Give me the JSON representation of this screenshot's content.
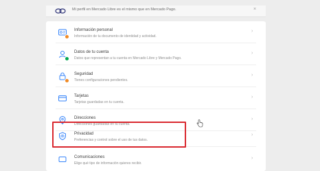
{
  "banner": {
    "message": "Mi perfil en Mercado Libre es el mismo que en Mercado Pago.",
    "close_label": "×",
    "logo_icon": "mercadolibre-handshake-icon"
  },
  "settings": [
    {
      "title": "Información personal",
      "desc": "Información de tu documento de identidad y actividad.",
      "icon": "id-card-icon",
      "badge": "orange"
    },
    {
      "title": "Datos de tu cuenta",
      "desc": "Datos que representan a tu cuenta en Mercado Libre y Mercado Pago.",
      "icon": "user-icon",
      "badge": "green"
    },
    {
      "title": "Seguridad",
      "desc": "Tienes configuraciones pendientes.",
      "icon": "lock-icon",
      "badge": "orange"
    },
    {
      "title": "Tarjetas",
      "desc": "Tarjetas guardadas en tu cuenta.",
      "icon": "card-icon",
      "badge": ""
    },
    {
      "title": "Direcciones",
      "desc": "Direcciones guardadas en tu cuenta.",
      "icon": "location-pin-icon",
      "badge": ""
    },
    {
      "title": "Privacidad",
      "desc": "Preferencias y control sobre el uso de tus datos.",
      "icon": "privacy-icon",
      "badge": ""
    },
    {
      "title": "Comunicaciones",
      "desc": "Elige qué tipo de información quieres recibir.",
      "icon": "chat-icon",
      "badge": ""
    }
  ],
  "chevron": "›",
  "colors": {
    "accent": "#3483fa",
    "badge_orange": "#f08a24",
    "badge_green": "#00a650",
    "highlight": "#d9272e"
  }
}
